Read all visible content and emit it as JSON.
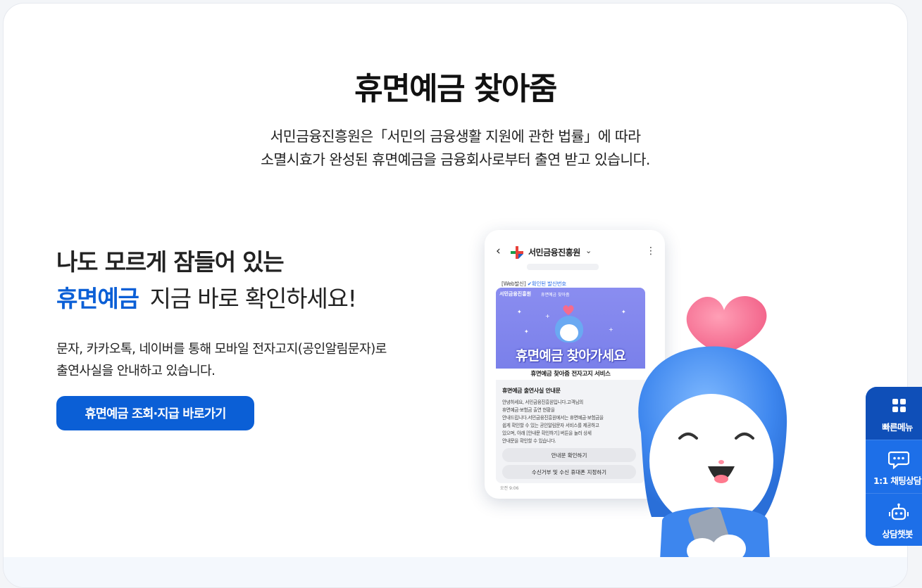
{
  "page": {
    "title": "휴면예금 찾아줌",
    "description_lines": [
      "서민금융진흥원은「서민의 금융생활 지원에 관한 법률」에 따라",
      "소멸시효가 완성된 휴면예금을 금융회사로부터 출연 받고 있습니다."
    ]
  },
  "promo": {
    "headline_line1": "나도 모르게 잠들어 있는",
    "headline_highlight": "휴면예금",
    "headline_rest": "지금 바로 확인하세요!",
    "body_lines": [
      "문자, 카카오톡, 네이버를 통해 모바일 전자고지(공인알림문자)로",
      "출연사실을 안내하고 있습니다."
    ],
    "cta_label": "휴면예금 조회·지급 바로가기"
  },
  "phone": {
    "back_glyph": "‹",
    "sender": "서민금융진흥원",
    "caret": "⌄",
    "more_glyph": "⋮",
    "badge_prefix": "[Web발신]",
    "badge_verified": "확인된 발신번호",
    "banner_brand": "서민금융진흥원",
    "banner_sub": "휴면예금 찾아줌",
    "banner_title": "휴면예금 찾아가세요",
    "banner_caption": "휴면예금 찾아줌 전자고지 서비스",
    "message_heading": "휴면예금 출연사실 안내문",
    "message_lines": [
      "안녕하세요, 서민금융진흥원입니다.고객님의",
      "휴면예금·보험금 출연 현황을",
      "안내드립니다.서민금융진흥원에서는 휴면예금·보험금을",
      "쉽게 확인할 수 있는 공인알림문자 서비스를 제공하고",
      "있으며, 아래 [안내문 확인하기] 버튼을 눌러 상세",
      "안내문을 확인할 수 있습니다."
    ],
    "button1": "안내문 확인하기",
    "button2": "수신거부 및 수신 휴대폰 지정하기",
    "time": "오전 9:06"
  },
  "side_menu": {
    "quick_menu": "빠른메뉴",
    "chat_consult": "1:1 채팅상담",
    "chatbot": "상담챗봇"
  },
  "colors": {
    "accent": "#0b5fd6",
    "side_dark": "#0f4fb8",
    "side_light": "#1d6fe8",
    "banner": "#8a8df0"
  },
  "icons": {
    "side_quick": "grid-icon",
    "side_chat": "chat-bubble-icon",
    "side_bot": "robot-icon"
  }
}
